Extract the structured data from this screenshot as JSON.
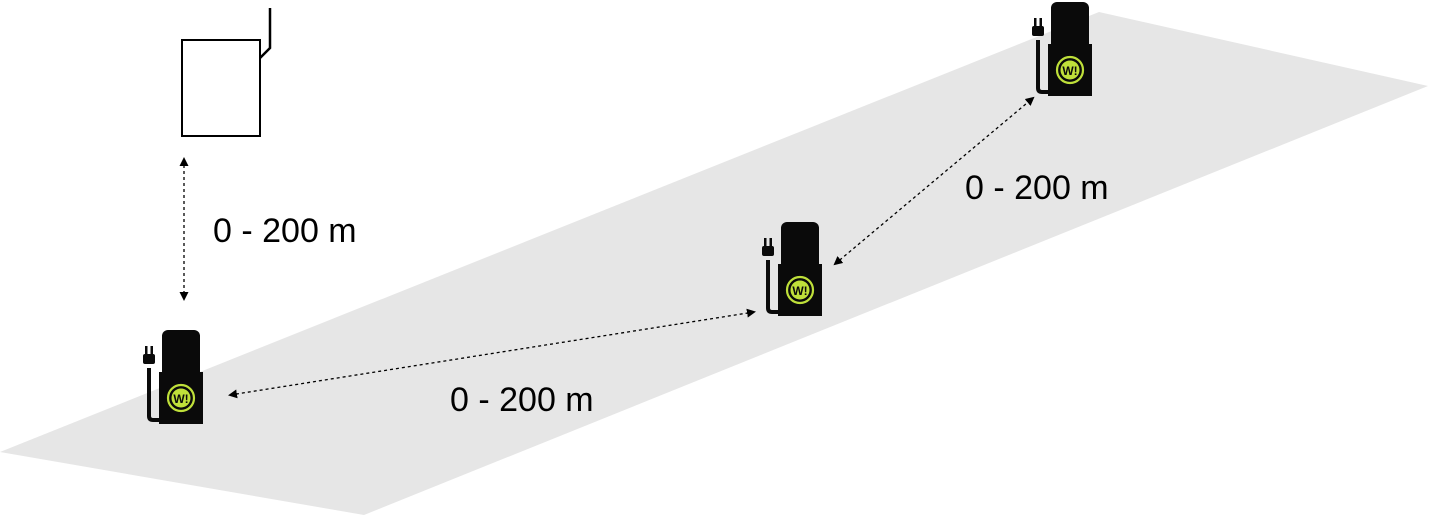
{
  "colors": {
    "ground": "#e6e6e6",
    "charger_body": "#0a0a0a",
    "charger_logo_ring": "#bfe03a",
    "charger_logo_text": "#bfe03a",
    "arrow": "#000000",
    "gateway_fill": "#ffffff",
    "gateway_stroke": "#000000"
  },
  "icons": {
    "gateway": "wireless-gateway-icon",
    "charger": "ev-charger-icon",
    "plug": "plug-icon"
  },
  "chargers": [
    {
      "logo_text": "W!"
    },
    {
      "logo_text": "W!"
    },
    {
      "logo_text": "W!"
    }
  ],
  "links": [
    {
      "label": "0 - 200 m"
    },
    {
      "label": "0 - 200 m"
    },
    {
      "label": "0 - 200 m"
    }
  ]
}
